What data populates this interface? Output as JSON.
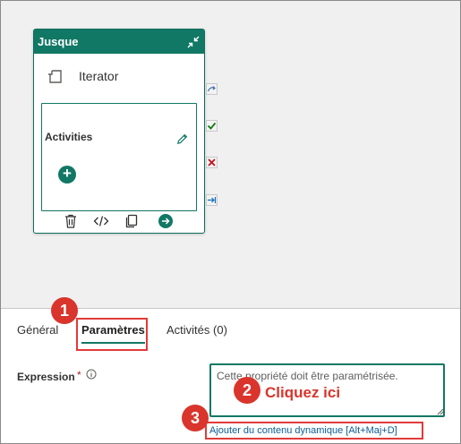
{
  "canvas": {
    "activity": {
      "title": "Jusque",
      "iterator_label": "Iterator",
      "activities_label": "Activities",
      "add_icon": "plus-icon",
      "toolbar_icons": [
        "delete-icon",
        "code-icon",
        "copy-icon",
        "go-icon"
      ]
    },
    "side_connectors": [
      "skip-icon",
      "success-icon",
      "fail-icon",
      "completion-icon"
    ]
  },
  "tabs": [
    {
      "label": "Général",
      "active": false
    },
    {
      "label": "Paramètres",
      "active": true
    },
    {
      "label": "Activités (0)",
      "active": false
    }
  ],
  "settings": {
    "expression_label": "Expression",
    "required_mark": "*",
    "expression_value": "Cette propriété doit être paramétrisée.",
    "dynamic_content_link": "Ajouter du contenu dynamique [Alt+Maj+D]"
  },
  "annotations": {
    "badge_1": "1",
    "badge_2": "2",
    "badge_3": "3",
    "callout_text": "Cliquez ici"
  },
  "colors": {
    "accent": "#117865",
    "annotation_red": "#d9352c",
    "link_blue": "#0f5c94"
  }
}
